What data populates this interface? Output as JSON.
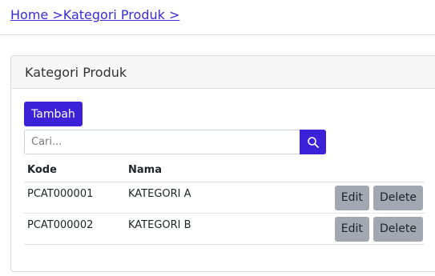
{
  "breadcrumb": {
    "text": "Home >Kategori Produk >"
  },
  "card": {
    "title": "Kategori Produk"
  },
  "toolbar": {
    "add_label": "Tambah"
  },
  "search": {
    "placeholder": "Cari...",
    "value": "",
    "icon": "search-icon"
  },
  "table": {
    "headers": [
      "Kode",
      "Nama"
    ],
    "rows": [
      {
        "code": "PCAT000001",
        "name": "KATEGORI A",
        "edit_label": "Edit",
        "delete_label": "Delete"
      },
      {
        "code": "PCAT000002",
        "name": "KATEGORI B",
        "edit_label": "Edit",
        "delete_label": "Delete"
      }
    ]
  },
  "colors": {
    "primary": "#3b22d8",
    "link": "#3b2bd6",
    "secondary_button": "#a1a8b1",
    "header_bg": "#f7f7f7"
  }
}
